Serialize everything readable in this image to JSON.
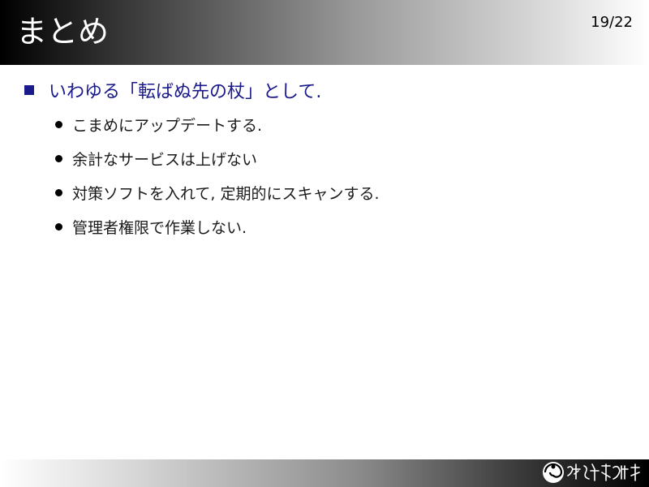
{
  "header": {
    "title": "まとめ",
    "page_number": "19/22"
  },
  "content": {
    "main_item": "いわゆる「転ばぬ先の杖」として.",
    "sub_items": [
      "こまめにアップデートする.",
      "余計なサービスは上げない",
      "対策ソフトを入れて, 定期的にスキャンする.",
      "管理者権限で作業しない."
    ]
  },
  "footer": {
    "logo": "organization-logo"
  }
}
